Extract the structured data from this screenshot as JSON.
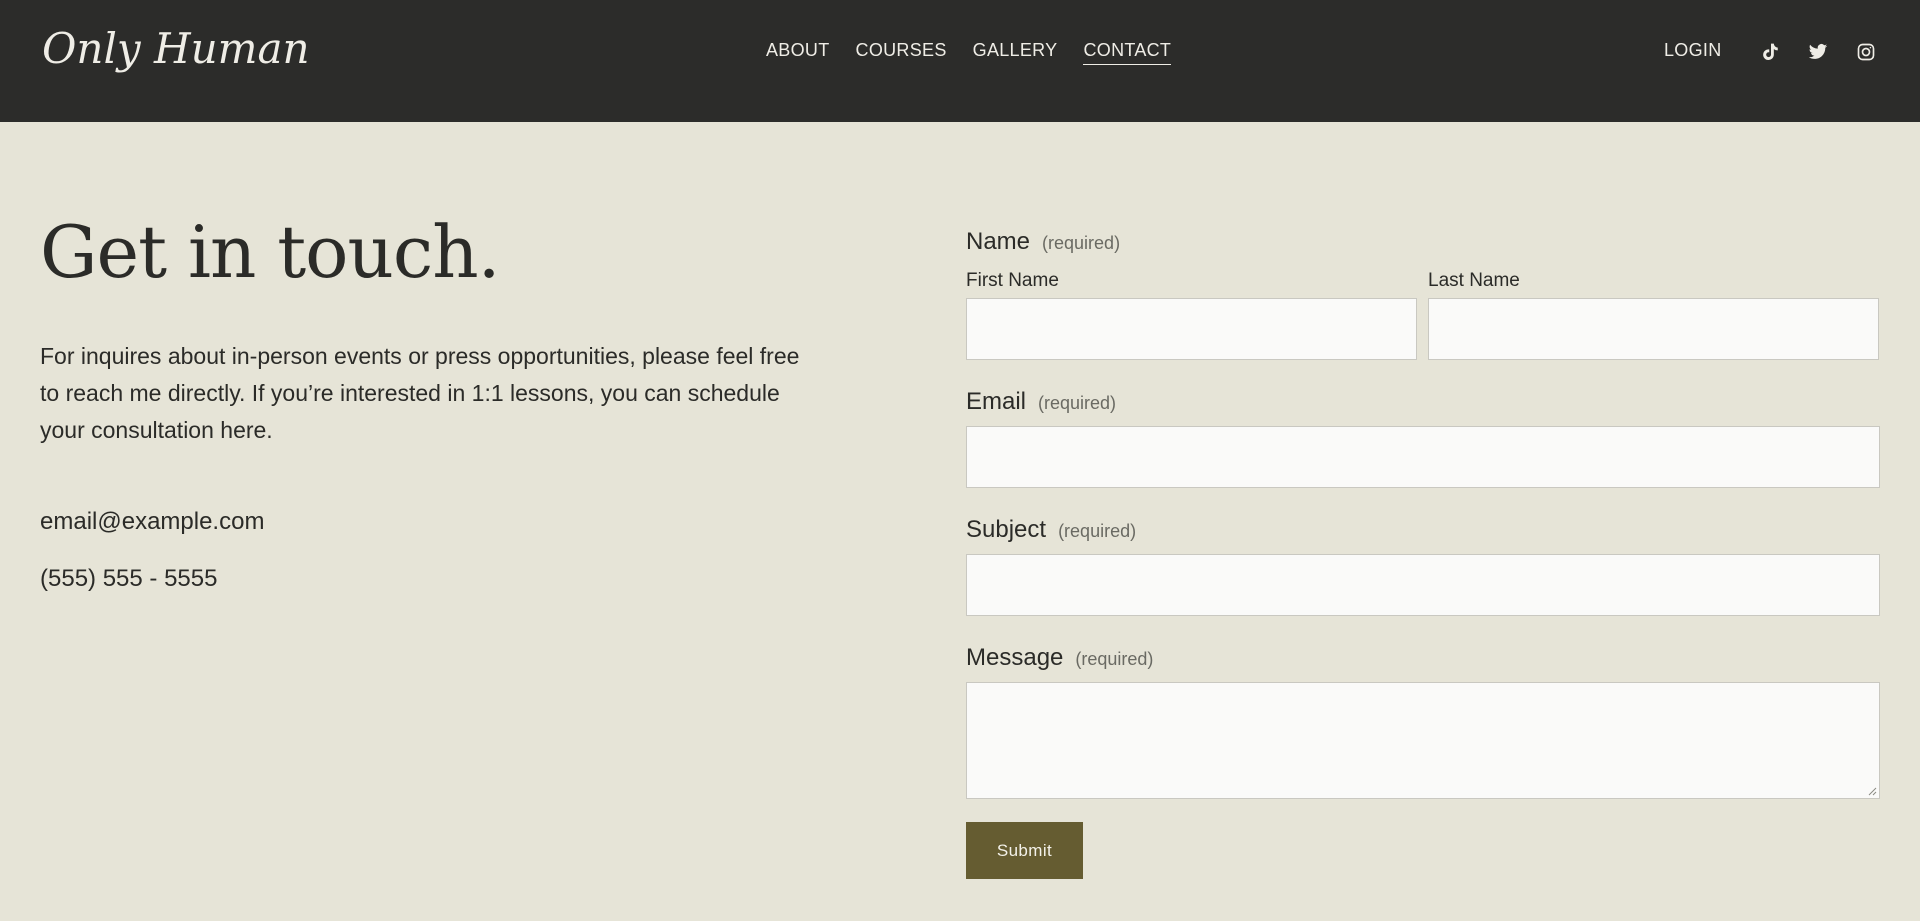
{
  "header": {
    "logo": "Only Human",
    "nav": [
      {
        "label": "ABOUT",
        "active": false
      },
      {
        "label": "COURSES",
        "active": false
      },
      {
        "label": "GALLERY",
        "active": false
      },
      {
        "label": "CONTACT",
        "active": true
      }
    ],
    "login": "LOGIN",
    "social_icons": [
      "tiktok-icon",
      "twitter-icon",
      "instagram-icon"
    ]
  },
  "main": {
    "heading": "Get in touch.",
    "intro": "For inquires about in-person events or press opportunities, please feel free to reach me directly. If you’re interested in 1:1 lessons, you can schedule your consultation here.",
    "email": "email@example.com",
    "phone": "(555) 555 - 5555"
  },
  "form": {
    "required_text": "(required)",
    "name_label": "Name",
    "first_name_label": "First Name",
    "first_name_value": "",
    "last_name_label": "Last Name",
    "last_name_value": "",
    "email_label": "Email",
    "email_value": "",
    "subject_label": "Subject",
    "subject_value": "",
    "message_label": "Message",
    "message_value": "",
    "submit_label": "Submit"
  },
  "colors": {
    "header_bg": "#2c2c2a",
    "page_bg": "#e6e4d7",
    "submit_bg": "#655c31",
    "input_bg": "#fafaf9"
  }
}
